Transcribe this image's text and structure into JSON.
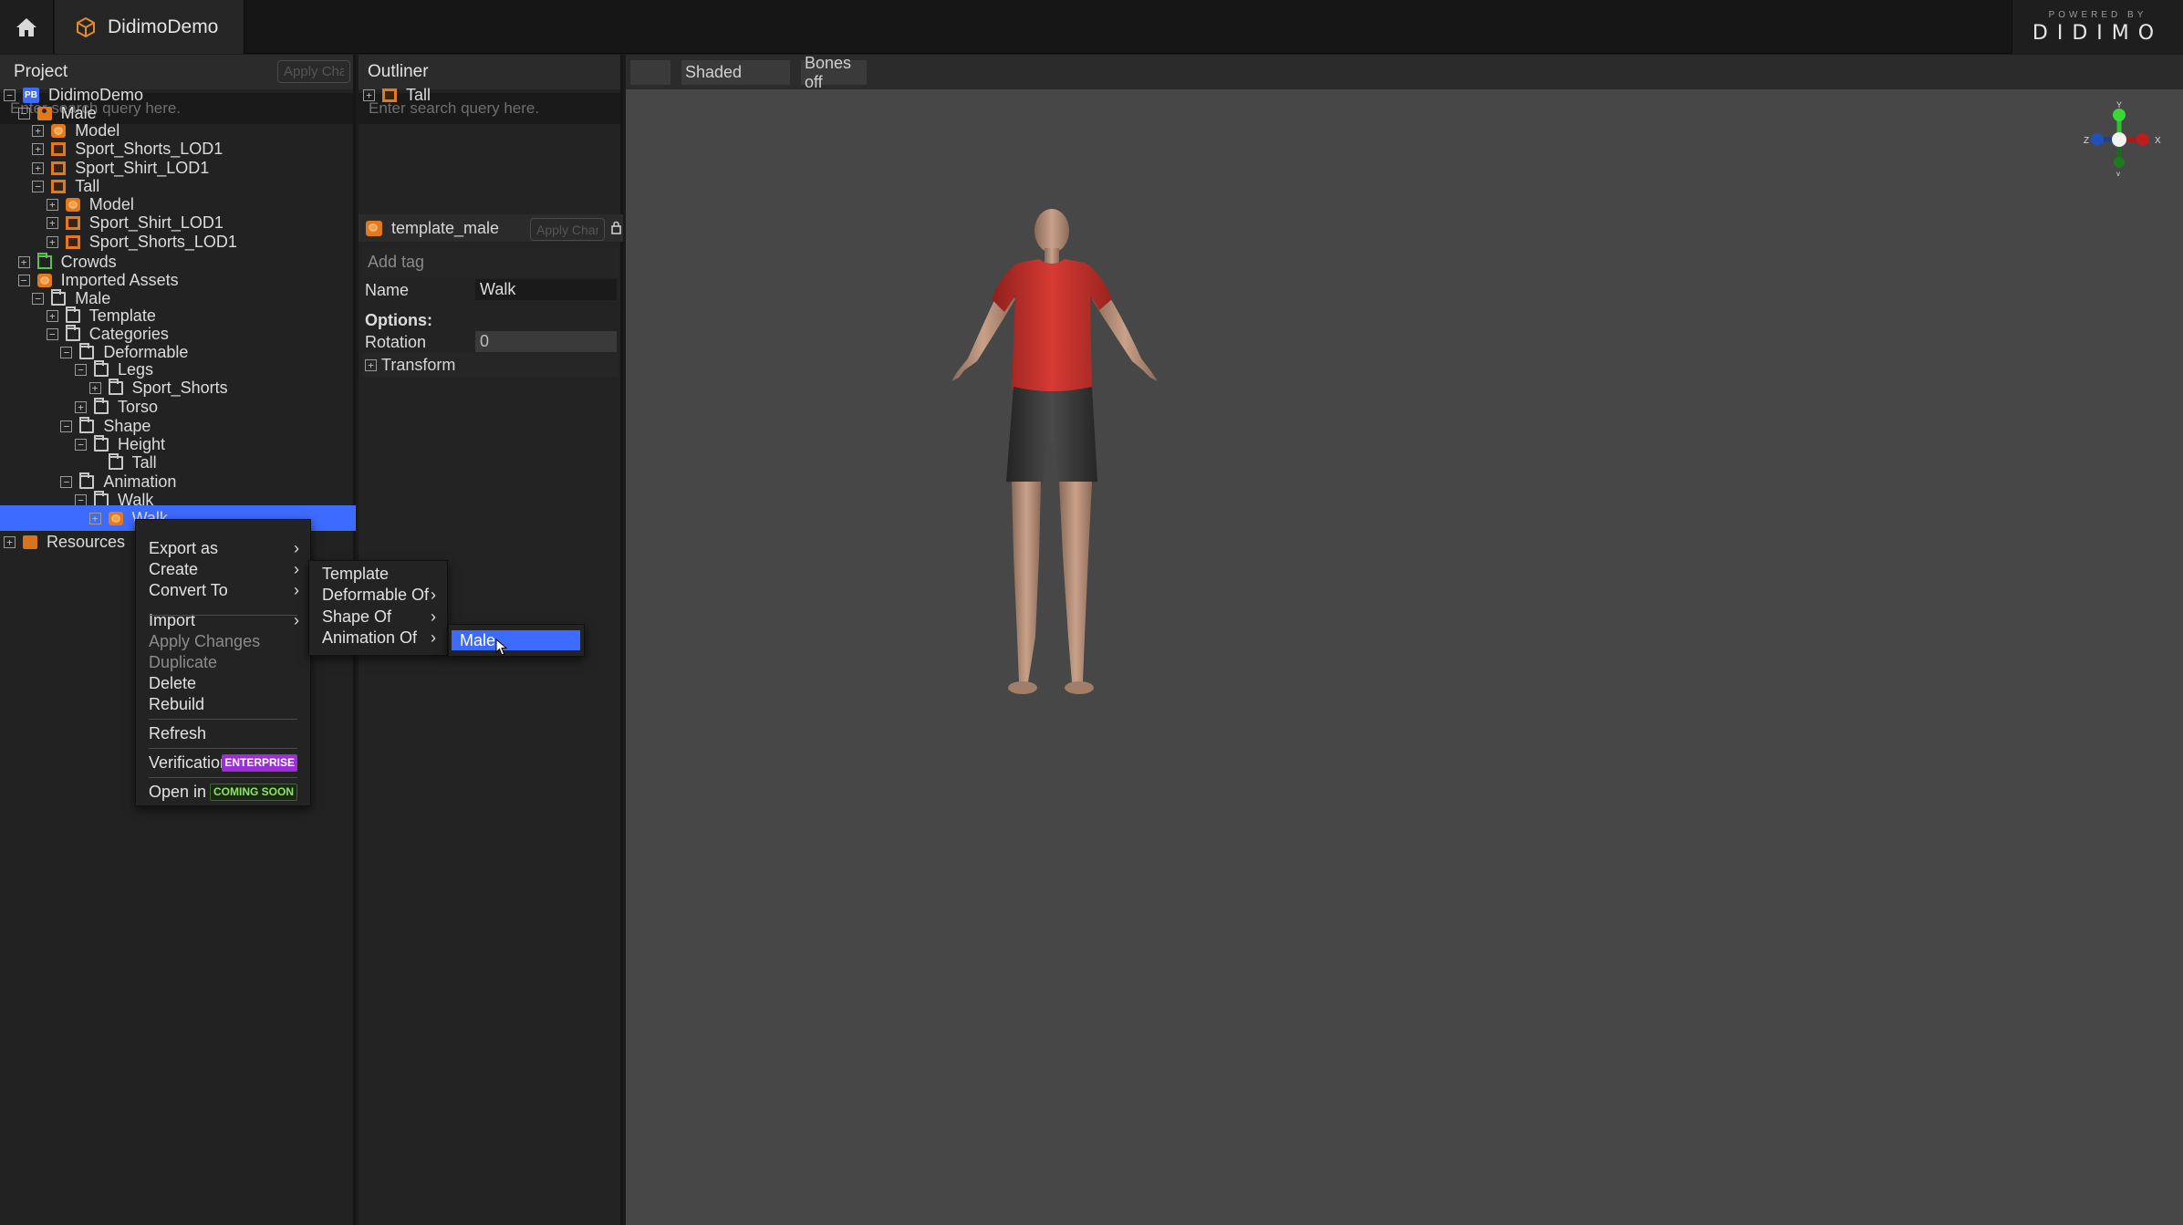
{
  "app": {
    "tab_title": "DidimoDemo"
  },
  "brand": {
    "powered_by": "POWERED BY",
    "logo": "DIDIMO"
  },
  "project": {
    "title": "Project",
    "apply_label": "Apply Changes",
    "search_placeholder": "Enter search query here.",
    "tree": [
      {
        "label": "DidimoDemo",
        "depth": 0,
        "expander": "−",
        "icon": "project-icon"
      },
      {
        "label": "Male",
        "depth": 1,
        "expander": "−",
        "icon": "person-icon"
      },
      {
        "label": "Model",
        "depth": 2,
        "expander": "+",
        "icon": "model-icon"
      },
      {
        "label": "Sport_Shorts_LOD1",
        "depth": 2,
        "expander": "+",
        "icon": "garment-icon"
      },
      {
        "label": "Sport_Shirt_LOD1",
        "depth": 2,
        "expander": "+",
        "icon": "garment-icon"
      },
      {
        "label": "Tall",
        "depth": 2,
        "expander": "−",
        "icon": "shape-icon"
      },
      {
        "label": "Model",
        "depth": 3,
        "expander": "+",
        "icon": "model-icon"
      },
      {
        "label": "Sport_Shirt_LOD1",
        "depth": 3,
        "expander": "+",
        "icon": "garment-icon"
      },
      {
        "label": "Sport_Shorts_LOD1",
        "depth": 3,
        "expander": "+",
        "icon": "garment-icon"
      },
      {
        "label": "Crowds",
        "depth": 1,
        "expander": "+",
        "icon": "crowds-folder-icon"
      },
      {
        "label": "Imported Assets",
        "depth": 1,
        "expander": "−",
        "icon": "assets-icon"
      },
      {
        "label": "Male",
        "depth": 2,
        "expander": "−",
        "icon": "folder-icon"
      },
      {
        "label": "Template",
        "depth": 3,
        "expander": "+",
        "icon": "folder-icon"
      },
      {
        "label": "Categories",
        "depth": 3,
        "expander": "−",
        "icon": "folder-icon"
      },
      {
        "label": "Deformable",
        "depth": 4,
        "expander": "−",
        "icon": "folder-icon"
      },
      {
        "label": "Legs",
        "depth": 5,
        "expander": "−",
        "icon": "folder-icon"
      },
      {
        "label": "Sport_Shorts",
        "depth": 6,
        "expander": "+",
        "icon": "folder-icon"
      },
      {
        "label": "Torso",
        "depth": 5,
        "expander": "+",
        "icon": "folder-icon"
      },
      {
        "label": "Shape",
        "depth": 4,
        "expander": "−",
        "icon": "folder-icon"
      },
      {
        "label": "Height",
        "depth": 5,
        "expander": "−",
        "icon": "folder-icon"
      },
      {
        "label": "Tall",
        "depth": 6,
        "expander": "",
        "icon": "folder-icon"
      },
      {
        "label": "Animation",
        "depth": 4,
        "expander": "−",
        "icon": "folder-icon"
      },
      {
        "label": "Walk",
        "depth": 5,
        "expander": "−",
        "icon": "folder-icon"
      },
      {
        "label": "Walk",
        "depth": 6,
        "expander": "+",
        "icon": "animation-icon",
        "selected": true
      },
      {
        "label": "Resources",
        "depth": 0,
        "expander": "+",
        "icon": "resources-icon"
      }
    ]
  },
  "outliner": {
    "title": "Outliner",
    "search_placeholder": "Enter search query here.",
    "items": [
      {
        "label": "Tall",
        "expander": "+"
      }
    ]
  },
  "properties": {
    "object_name": "template_male",
    "apply_label": "Apply Changes",
    "add_tag": "Add tag",
    "name_label": "Name",
    "name_value": "Walk",
    "options_label": "Options:",
    "rotation_label": "Rotation",
    "rotation_value": "0",
    "transform_label": "Transform"
  },
  "viewport": {
    "shading_mode": "Shaded",
    "bones_mode": "Bones off",
    "gizmo": {
      "y": "Y",
      "x": "X",
      "z": "Z"
    }
  },
  "context_menu": {
    "items": [
      {
        "label": "Export as",
        "submenu": true,
        "enabled": true
      },
      {
        "label": "Create",
        "submenu": true,
        "enabled": true
      },
      {
        "label": "Convert To",
        "submenu": true,
        "enabled": true
      },
      {
        "label": "Import",
        "submenu": true,
        "enabled": true
      },
      {
        "label": "Apply Changes",
        "submenu": false,
        "enabled": false
      },
      {
        "label": "Duplicate",
        "submenu": false,
        "enabled": false
      },
      {
        "label": "Delete",
        "submenu": false,
        "enabled": true
      },
      {
        "label": "Rebuild",
        "submenu": false,
        "enabled": true
      },
      {
        "label": "Refresh",
        "submenu": false,
        "enabled": true
      },
      {
        "label": "Verification",
        "badge": "ENTERPRISE",
        "enabled": true
      },
      {
        "label": "Open in Terminal",
        "badge": "COMING SOON",
        "enabled": true
      }
    ]
  },
  "convert_submenu": {
    "items": [
      {
        "label": "Template",
        "submenu": false
      },
      {
        "label": "Deformable Of",
        "submenu": true
      },
      {
        "label": "Shape Of",
        "submenu": true
      },
      {
        "label": "Animation Of",
        "submenu": true
      }
    ]
  },
  "animation_of_submenu": {
    "items": [
      {
        "label": "Male",
        "highlighted": true
      }
    ]
  },
  "colors": {
    "accent": "#3d6bff",
    "orange_icon": "#e07a1d",
    "enterprise_badge": "#9a2fd6",
    "coming_soon_text": "#8fe36a",
    "viewport_bg": "#474747",
    "shirt": "#c8302c"
  }
}
